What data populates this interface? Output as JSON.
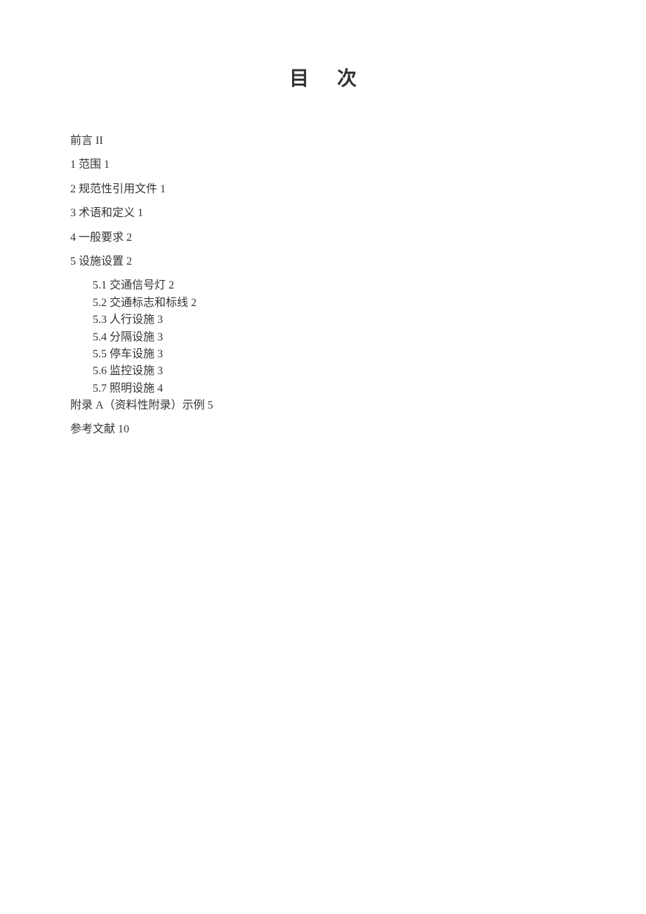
{
  "title": "目次",
  "entries": [
    {
      "type": "main",
      "text": "前言 II"
    },
    {
      "type": "main",
      "text": "1 范围 1"
    },
    {
      "type": "main",
      "text": "2 规范性引用文件 1"
    },
    {
      "type": "main",
      "text": "3 术语和定义 1"
    },
    {
      "type": "main",
      "text": "4 一般要求 2"
    },
    {
      "type": "main",
      "text": "5 设施设置 2"
    },
    {
      "type": "sub",
      "text": "5.1 交通信号灯 2"
    },
    {
      "type": "sub",
      "text": "5.2 交通标志和标线 2"
    },
    {
      "type": "sub",
      "text": "5.3 人行设施 3"
    },
    {
      "type": "sub",
      "text": "5.4 分隔设施 3"
    },
    {
      "type": "sub",
      "text": "5.5 停车设施 3"
    },
    {
      "type": "sub",
      "text": "5.6 监控设施 3"
    },
    {
      "type": "sub",
      "text": "5.7 照明设施 4"
    },
    {
      "type": "main",
      "text": "附录 A（资料性附录）示例 5"
    },
    {
      "type": "main",
      "text": "参考文献 10"
    }
  ]
}
